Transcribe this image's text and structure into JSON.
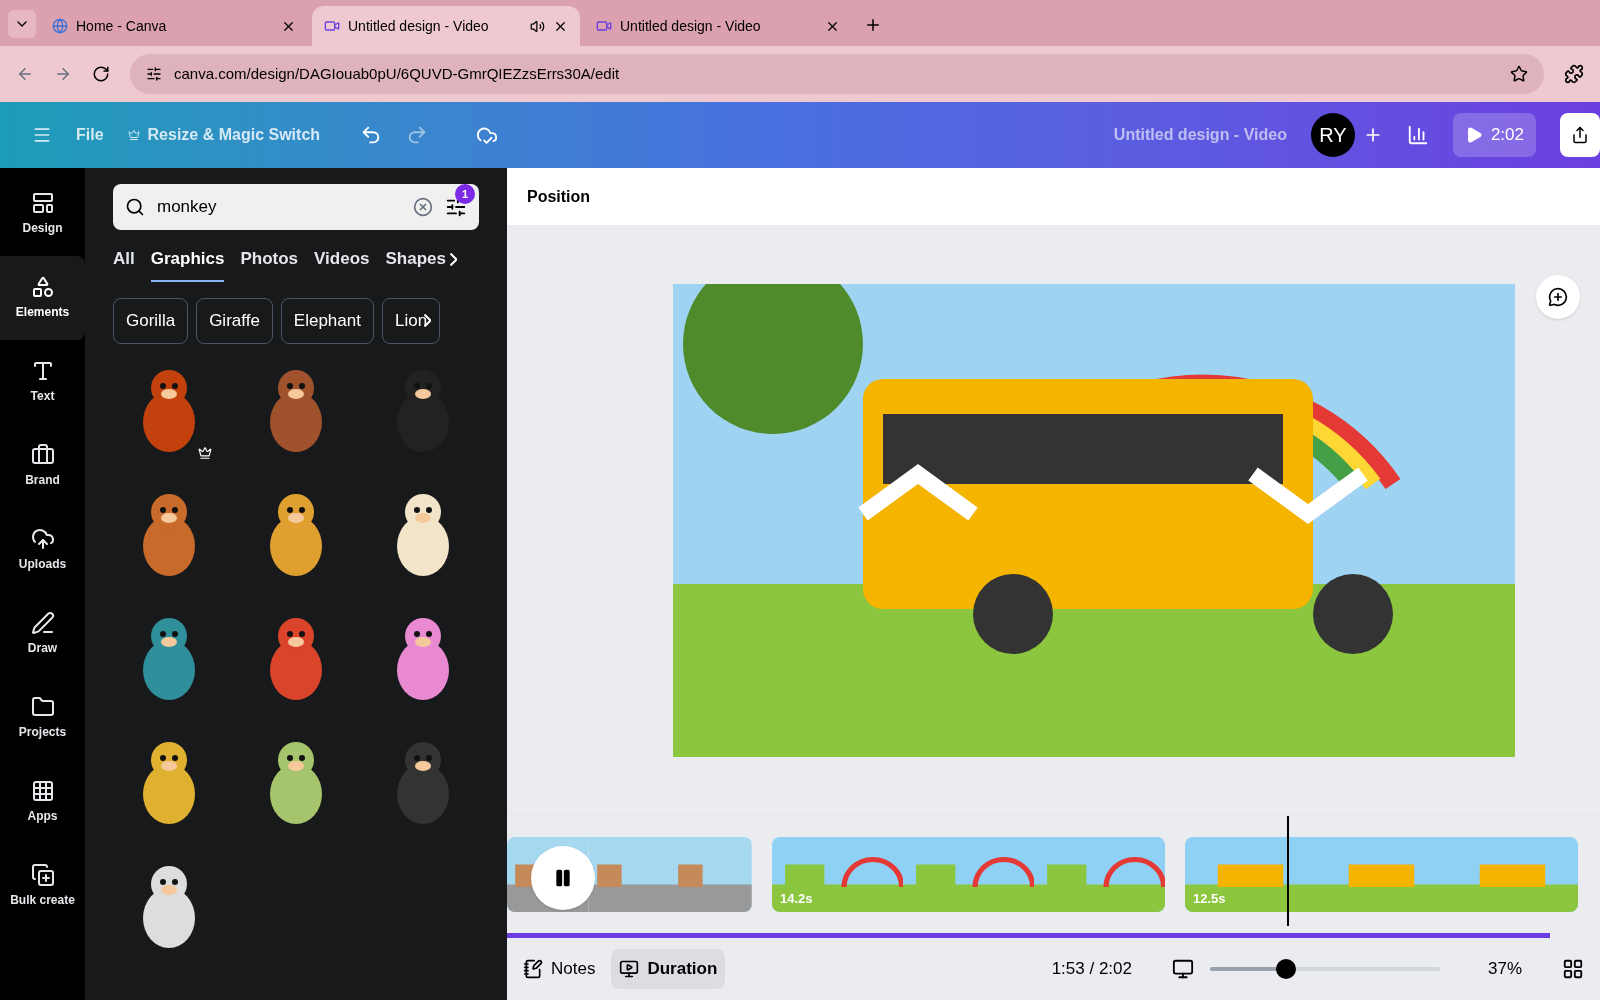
{
  "browser": {
    "tabs": [
      {
        "title": "Home - Canva",
        "selected": false,
        "kind": "home",
        "audio": false
      },
      {
        "title": "Untitled design - Video",
        "selected": true,
        "kind": "video",
        "audio": true
      },
      {
        "title": "Untitled design - Video",
        "selected": false,
        "kind": "video",
        "audio": false
      }
    ],
    "url": "canva.com/design/DAGIouab0pU/6QUVD-GmrQIEZzsErrs30A/edit"
  },
  "topbar": {
    "file": "File",
    "resize": "Resize & Magic Switch",
    "title": "Untitled design - Video",
    "avatar": "RY",
    "play_time": "2:02"
  },
  "rail": [
    {
      "label": "Design",
      "kind": "design",
      "selected": false
    },
    {
      "label": "Elements",
      "kind": "elements",
      "selected": true
    },
    {
      "label": "Text",
      "kind": "text",
      "selected": false
    },
    {
      "label": "Brand",
      "kind": "brand",
      "selected": false
    },
    {
      "label": "Uploads",
      "kind": "uploads",
      "selected": false
    },
    {
      "label": "Draw",
      "kind": "draw",
      "selected": false
    },
    {
      "label": "Projects",
      "kind": "projects",
      "selected": false
    },
    {
      "label": "Apps",
      "kind": "apps",
      "selected": false
    },
    {
      "label": "Bulk create",
      "kind": "bulk",
      "selected": false
    }
  ],
  "panel": {
    "search": {
      "value": "monkey",
      "filter_count": "1"
    },
    "tabs": [
      {
        "label": "All",
        "selected": false
      },
      {
        "label": "Graphics",
        "selected": true
      },
      {
        "label": "Photos",
        "selected": false
      },
      {
        "label": "Videos",
        "selected": false
      },
      {
        "label": "Shapes",
        "selected": false
      }
    ],
    "chips": [
      "Gorilla",
      "Giraffe",
      "Elephant",
      "Lion"
    ],
    "results": [
      {
        "premium": true
      },
      {
        "premium": false
      },
      {
        "premium": false
      },
      {
        "premium": false
      },
      {
        "premium": false
      },
      {
        "premium": false
      },
      {
        "premium": false
      },
      {
        "premium": false
      },
      {
        "premium": false
      },
      {
        "premium": false
      },
      {
        "premium": false
      },
      {
        "premium": false
      },
      {
        "premium": false
      }
    ]
  },
  "editor": {
    "toolbar_label": "Position",
    "clips": [
      {
        "kind": "street"
      },
      {
        "kind": "park",
        "duration": "14.2s"
      },
      {
        "kind": "bus",
        "duration": "12.5s"
      }
    ],
    "progress": {
      "level": 1
    },
    "footer": {
      "notes": "Notes",
      "duration": {
        "label": "Duration",
        "selected": true
      },
      "time": "1:53 / 2:02",
      "zoom": {
        "level": 0.33,
        "reading": "37%"
      }
    }
  }
}
